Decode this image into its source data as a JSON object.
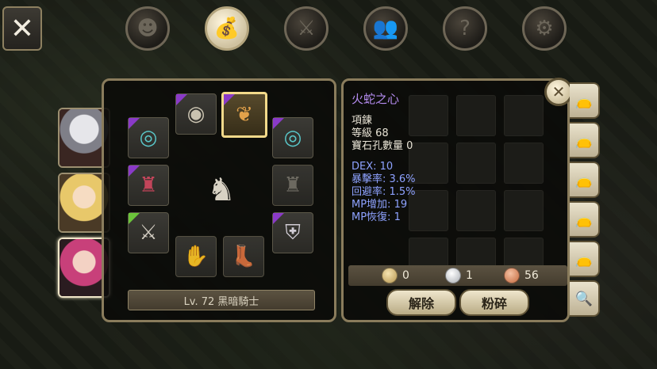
{
  "nav": {
    "close_symbol": "✕",
    "tabs": [
      {
        "name": "character-tab",
        "icon": "head-icon",
        "glyph": "☻",
        "active": false
      },
      {
        "name": "bag-tab",
        "icon": "bag-icon",
        "glyph": "💰",
        "active": true
      },
      {
        "name": "skill-tab",
        "icon": "sword-icon",
        "glyph": "⚔",
        "active": false
      },
      {
        "name": "party-tab",
        "icon": "people-icon",
        "glyph": "👥",
        "active": false
      },
      {
        "name": "quest-tab",
        "icon": "scroll-icon",
        "glyph": "?",
        "active": false
      },
      {
        "name": "settings-tab",
        "icon": "gear-icon",
        "glyph": "⚙",
        "active": false
      }
    ]
  },
  "portraits": [
    {
      "name": "portrait-white-hair",
      "selected": false
    },
    {
      "name": "portrait-blonde",
      "selected": false
    },
    {
      "name": "portrait-pink-hair",
      "selected": true
    }
  ],
  "equipment": {
    "level_label": "Lv. 72 黑暗騎士"
  },
  "item": {
    "name": "火蛇之心",
    "type": "項鍊",
    "grade": "等級 68",
    "gem_slots": "寶石孔數量 0",
    "stats": [
      "DEX: 10",
      "暴擊率: 3.6%",
      "回避率: 1.5%",
      "MP增加: 19",
      "MP恢復: 1"
    ],
    "currency": {
      "gold": "0",
      "silver": "1",
      "copper": "56"
    },
    "buttons": {
      "unequip": "解除",
      "smash": "粉碎"
    }
  },
  "colors": {
    "accent_gold": "#f2d98a",
    "item_name": "#b58cf0",
    "stat_blue": "#8ea2ff",
    "rarity_purple": "#8a3ac8",
    "rarity_green": "#6bc43a"
  }
}
